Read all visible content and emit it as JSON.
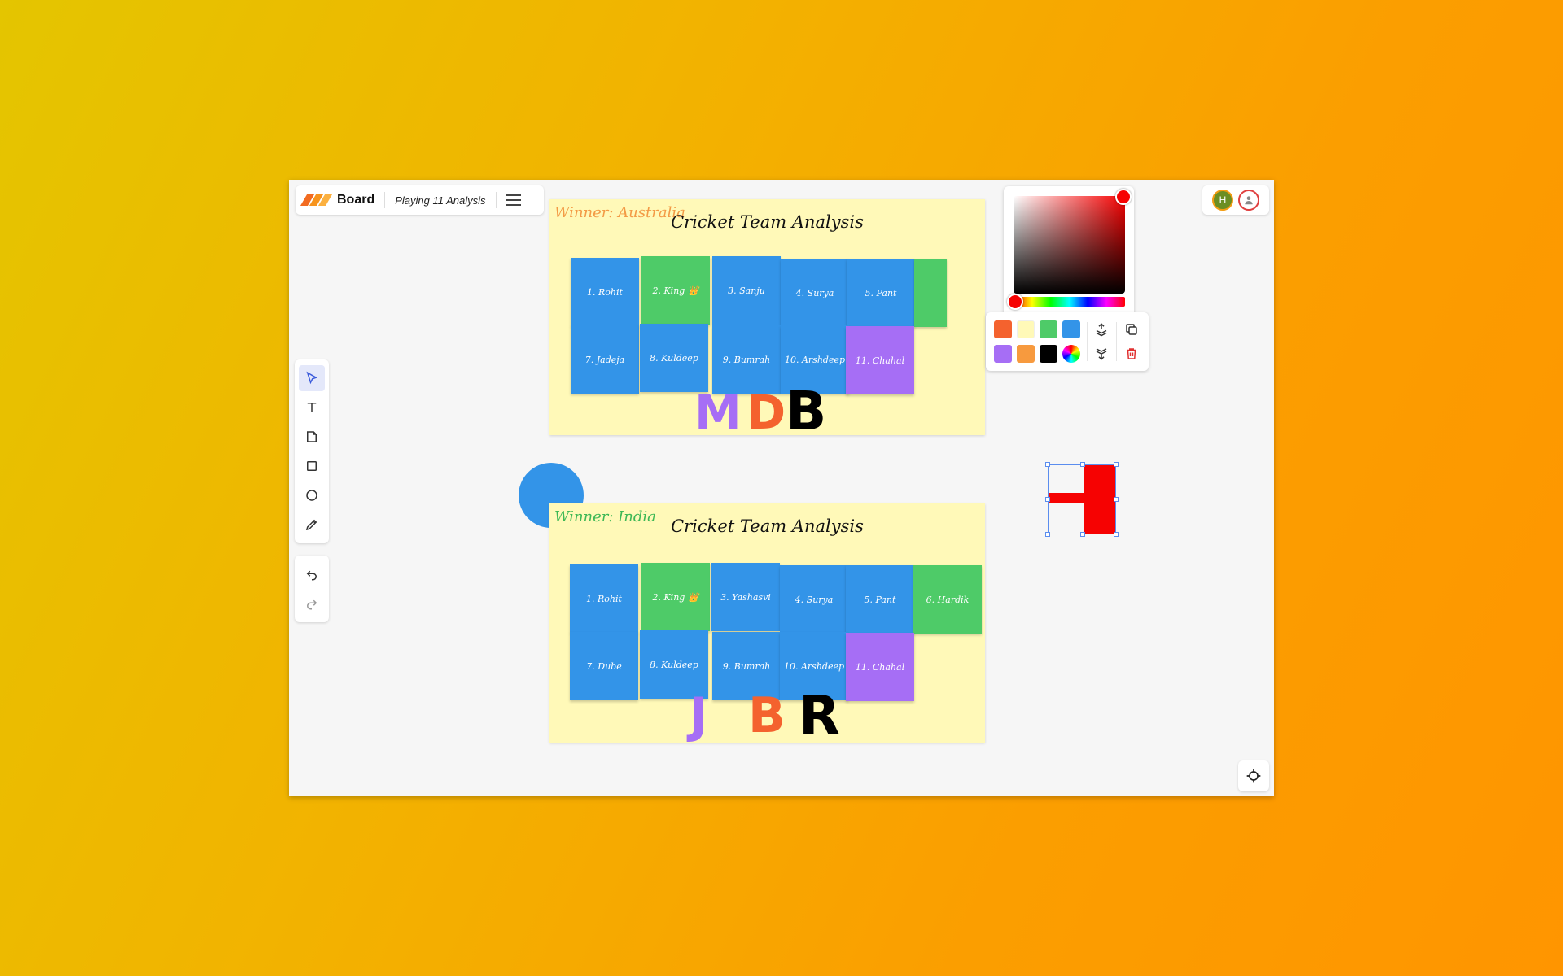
{
  "header": {
    "brand": "Board",
    "board_name": "Playing 11 Analysis"
  },
  "toolbar": {
    "tools": [
      "select",
      "text",
      "sticky-note",
      "rectangle",
      "ellipse",
      "pencil"
    ],
    "history": [
      "undo",
      "redo"
    ]
  },
  "avatars": [
    {
      "initial": "H"
    },
    {
      "initial": ""
    }
  ],
  "board1": {
    "winner": "Winner: Australia",
    "title": "Cricket Team Analysis",
    "notes": [
      {
        "label": "1. Rohit",
        "color": "blue"
      },
      {
        "label": "2. King 👑",
        "color": "green"
      },
      {
        "label": "3. Sanju",
        "color": "blue"
      },
      {
        "label": "4. Surya",
        "color": "blue"
      },
      {
        "label": "5. Pant",
        "color": "blue"
      },
      {
        "label": "7. Jadeja",
        "color": "blue"
      },
      {
        "label": "8. Kuldeep",
        "color": "blue"
      },
      {
        "label": "9. Bumrah",
        "color": "blue"
      },
      {
        "label": "10. Arshdeep",
        "color": "blue"
      },
      {
        "label": "11. Chahal",
        "color": "purple"
      }
    ],
    "scrawl": [
      "M",
      "D",
      "B"
    ]
  },
  "board2": {
    "winner": "Winner: India",
    "title": "Cricket Team Analysis",
    "notes": [
      {
        "label": "1. Rohit",
        "color": "blue"
      },
      {
        "label": "2. King 👑",
        "color": "green"
      },
      {
        "label": "3. Yashasvi",
        "color": "blue"
      },
      {
        "label": "4. Surya",
        "color": "blue"
      },
      {
        "label": "5. Pant",
        "color": "blue"
      },
      {
        "label": "6. Hardik",
        "color": "green"
      },
      {
        "label": "7. Dube",
        "color": "blue"
      },
      {
        "label": "8. Kuldeep",
        "color": "blue"
      },
      {
        "label": "9. Bumrah",
        "color": "blue"
      },
      {
        "label": "10. Arshdeep",
        "color": "blue"
      },
      {
        "label": "11. Chahal",
        "color": "purple"
      }
    ],
    "scrawl": [
      "J",
      "B",
      "R"
    ]
  },
  "color_picker": {
    "hex_value": "#f60202"
  },
  "palette": {
    "swatches": [
      "#f4622e",
      "#fff9b8",
      "#4ecb68",
      "#3394e8",
      "#a66ef5",
      "#f79a3e",
      "#000000",
      "rainbow"
    ],
    "actions": [
      "bring-forward",
      "send-backward",
      "duplicate",
      "delete"
    ]
  },
  "colors": {
    "accent": "#f60202",
    "note_blue": "#3394e8",
    "note_green": "#4ecb68",
    "note_purple": "#a66ef5",
    "board_bg": "#fff9b8"
  }
}
